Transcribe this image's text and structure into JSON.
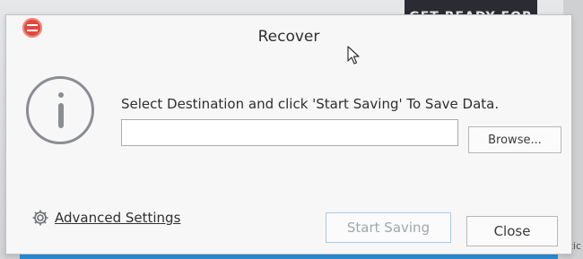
{
  "background": {
    "banner_text": "GET READY FOR",
    "edge_text": "tic"
  },
  "dialog": {
    "title": "Recover",
    "logo_icon": "app-logo-icon",
    "info_icon": "info-icon",
    "message": "Select Destination and click 'Start Saving' To Save Data.",
    "destination": {
      "value": "",
      "placeholder": ""
    },
    "browse_label": "Browse...",
    "advanced_settings_label": "Advanced Settings",
    "advanced_settings_icon": "gear-icon",
    "start_saving_label": "Start Saving",
    "close_label": "Close"
  },
  "colors": {
    "logo": "#e0493e",
    "taskbar": "#2d8fd6",
    "start_button_border": "#a8cbe6"
  }
}
